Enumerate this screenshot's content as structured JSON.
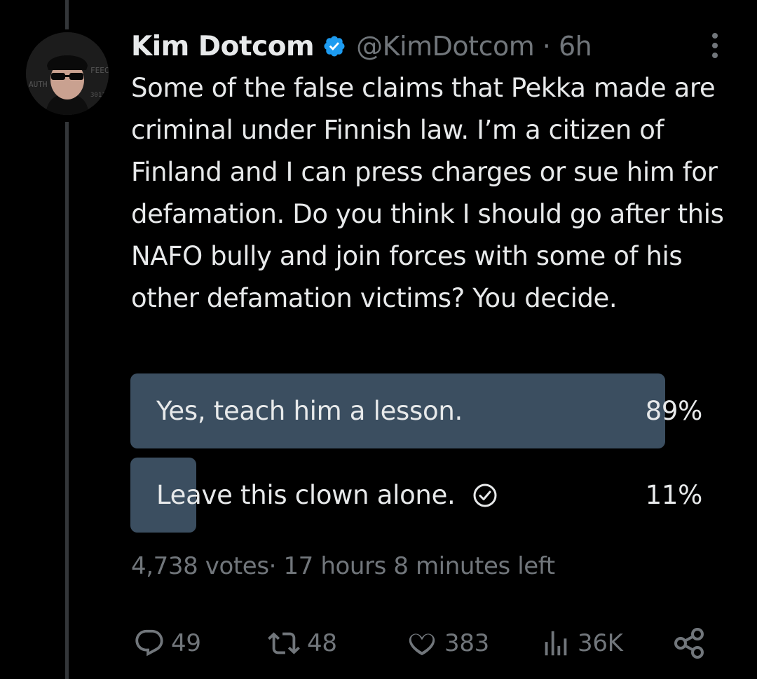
{
  "tweet": {
    "author_name": "Kim Dotcom",
    "handle_time": "@KimDotcom · 6h",
    "text": "Some of the false claims that Pekka made are criminal under Finnish law. I’m a citizen of Finland and I can press charges or sue him for defamation. Do you think I should go after this NAFO bully and join forces with some of his other defamation victims? You decide."
  },
  "icons": {
    "verified": "verified-badge-icon",
    "more": "more-options-icon",
    "voted": "check-circle-icon",
    "reply": "reply-icon",
    "retweet": "retweet-icon",
    "like": "like-icon",
    "views": "views-icon",
    "share": "share-icon"
  },
  "poll": {
    "options": [
      {
        "label": "Yes, teach him a lesson.",
        "percent_text": "89%",
        "fraction": 0.89,
        "voted": false
      },
      {
        "label": "Leave this clown alone.",
        "percent_text": "11%",
        "fraction": 0.11,
        "voted": true
      }
    ],
    "meta": "4,738 votes· 17 hours 8 minutes left"
  },
  "actions": {
    "replies": "49",
    "retweets": "48",
    "likes": "383",
    "views": "36K"
  },
  "colors": {
    "background": "#000000",
    "text": "#e7e9ea",
    "secondary_text": "#71767b",
    "poll_bar": "#3b4e60",
    "verified_blue": "#1d9bf0"
  }
}
